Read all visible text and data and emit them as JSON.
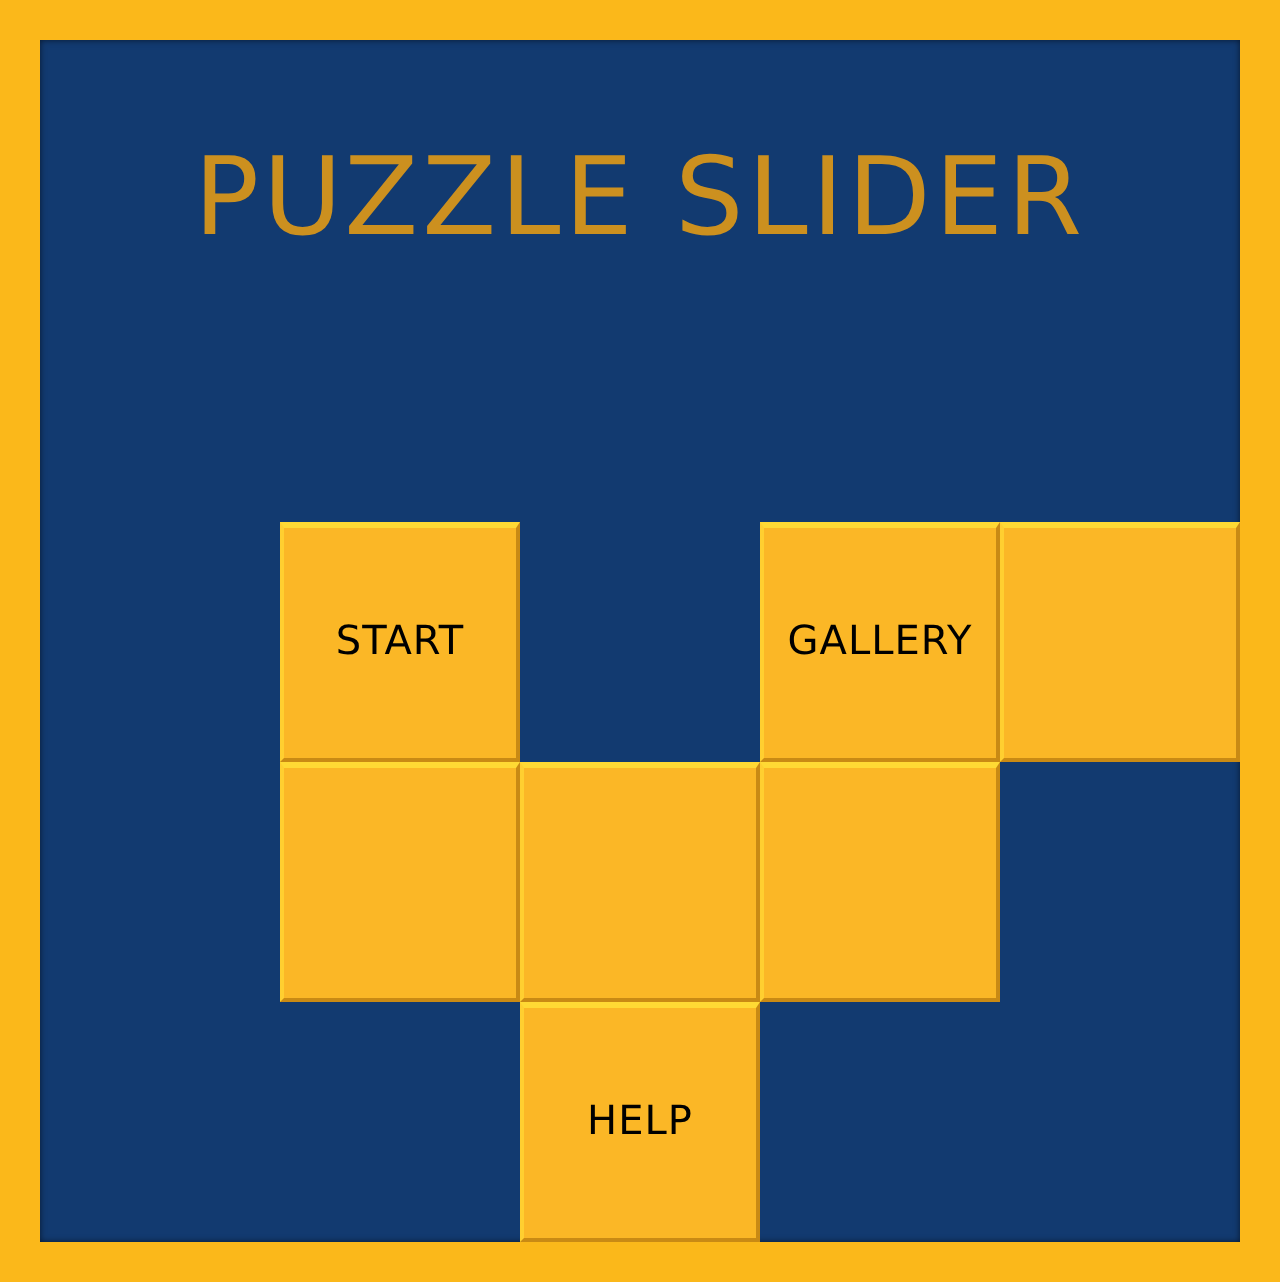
{
  "title": "PUZZLE SLIDER",
  "grid": [
    [
      {
        "kind": "tile",
        "label": "START"
      },
      {
        "kind": "empty"
      },
      {
        "kind": "tile",
        "label": "GALLERY"
      },
      {
        "kind": "tile"
      }
    ],
    [
      {
        "kind": "tile"
      },
      {
        "kind": "tile"
      },
      {
        "kind": "tile"
      },
      {
        "kind": "empty"
      }
    ],
    [
      {
        "kind": "empty"
      },
      {
        "kind": "tile",
        "label": "HELP"
      },
      {
        "kind": "empty"
      },
      {
        "kind": "empty"
      }
    ]
  ]
}
